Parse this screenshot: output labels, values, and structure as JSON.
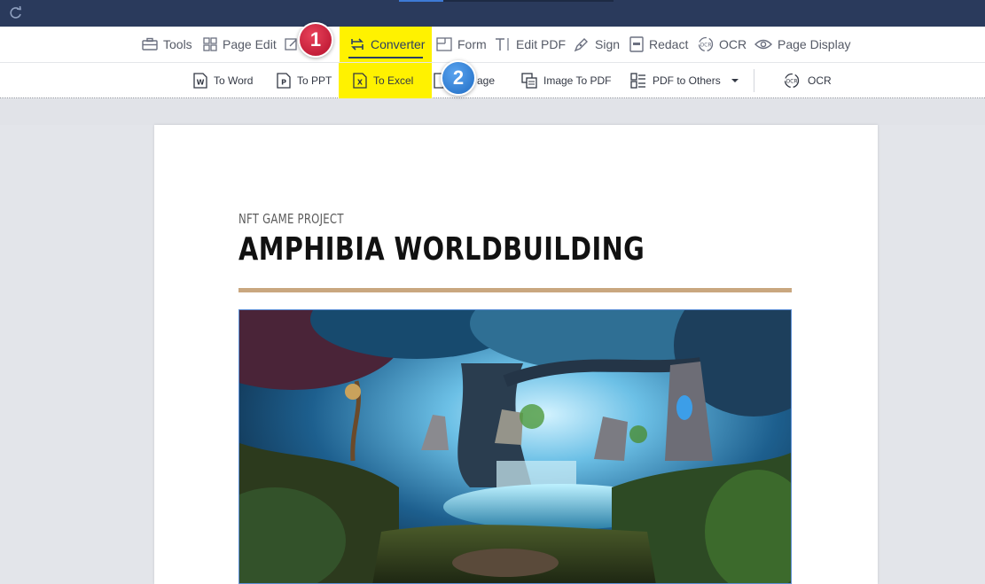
{
  "toolbar": {
    "items": [
      {
        "label": "Tools",
        "icon": "toolbox-icon"
      },
      {
        "label": "Page Edit",
        "icon": "grid-icon"
      },
      {
        "label": "Converter",
        "icon": "convert-icon"
      },
      {
        "label": "Form",
        "icon": "form-icon"
      },
      {
        "label": "Edit PDF",
        "icon": "text-edit-icon"
      },
      {
        "label": "Sign",
        "icon": "pen-icon"
      },
      {
        "label": "Redact",
        "icon": "redact-icon"
      },
      {
        "label": "OCR",
        "icon": "ocr-icon"
      },
      {
        "label": "Page Display",
        "icon": "eye-icon"
      }
    ],
    "active": "Converter"
  },
  "converter_bar": {
    "to_word": "To Word",
    "to_ppt": "To PPT",
    "to_excel": "To Excel",
    "to_image_partial": "age",
    "image_to_pdf": "Image To PDF",
    "pdf_to_others": "PDF to Others",
    "ocr": "OCR"
  },
  "callouts": {
    "step1": "1",
    "step2": "2"
  },
  "document": {
    "subtitle": "NFT GAME PROJECT",
    "title": "AMPHIBIA WORLDBUILDING"
  },
  "colors": {
    "highlight": "#fff200",
    "titlebar": "#2a3a5c",
    "rule": "#c9a77f",
    "badge1": "#d11f3c",
    "badge2": "#2f7fd6"
  }
}
